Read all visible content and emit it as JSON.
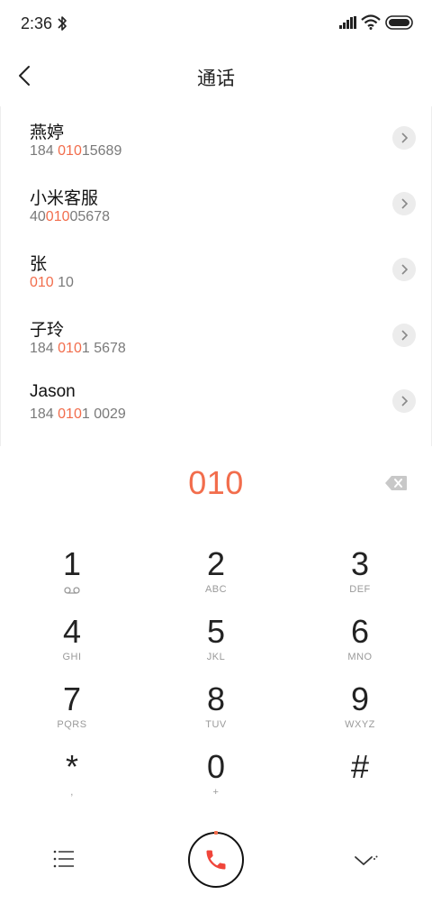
{
  "status_bar": {
    "time": "2:36",
    "icons": [
      "bluetooth-icon",
      "signal-icon",
      "wifi-icon",
      "battery-icon"
    ]
  },
  "header": {
    "title": "通话",
    "back_icon": "chevron-left-icon"
  },
  "contacts": [
    {
      "name": "燕婷",
      "number": {
        "pre": "184 ",
        "hl": "010",
        "post": "15689"
      }
    },
    {
      "name": "小米客服",
      "number": {
        "pre": "40",
        "hl": "010",
        "post": "05678"
      }
    },
    {
      "name": "张",
      "number": {
        "pre": "",
        "hl": "010",
        "post": " 10"
      }
    },
    {
      "name": "子玲",
      "number": {
        "pre": "184 ",
        "hl": "010",
        "post": "1 5678"
      }
    },
    {
      "name": "Jason",
      "number": {
        "pre": "184 ",
        "hl": "010",
        "post": "1 0029"
      }
    }
  ],
  "dialer": {
    "input": "010",
    "keys": [
      {
        "digit": "1",
        "sub": ""
      },
      {
        "digit": "2",
        "sub": "ABC"
      },
      {
        "digit": "3",
        "sub": "DEF"
      },
      {
        "digit": "4",
        "sub": "GHI"
      },
      {
        "digit": "5",
        "sub": "JKL"
      },
      {
        "digit": "6",
        "sub": "MNO"
      },
      {
        "digit": "7",
        "sub": "PQRS"
      },
      {
        "digit": "8",
        "sub": "TUV"
      },
      {
        "digit": "9",
        "sub": "WXYZ"
      },
      {
        "digit": "*",
        "sub": ","
      },
      {
        "digit": "0",
        "sub": "+"
      },
      {
        "digit": "#",
        "sub": ""
      }
    ]
  },
  "colors": {
    "accent": "#f26d4c",
    "text": "#222222",
    "secondary": "#7a7a7a"
  }
}
